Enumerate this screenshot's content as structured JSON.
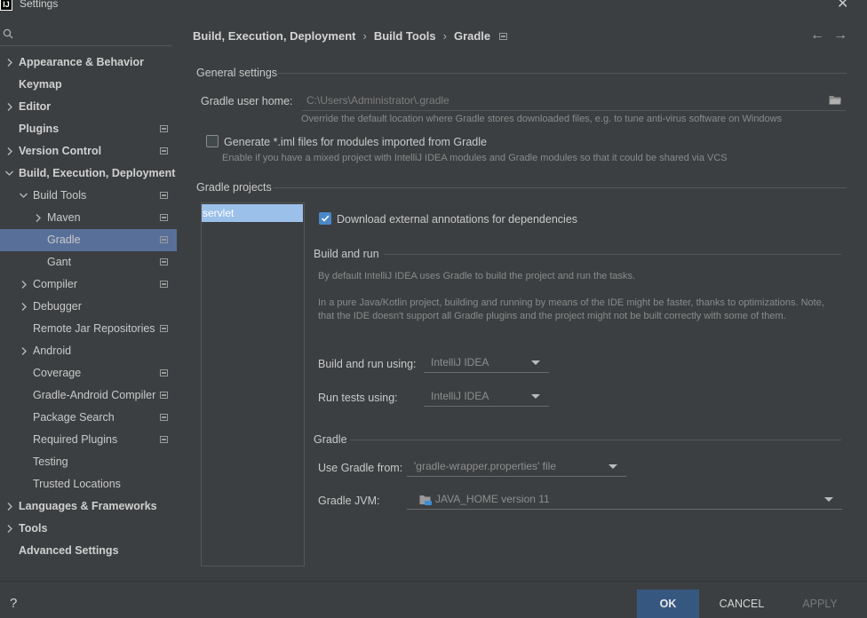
{
  "window": {
    "title": "Settings",
    "app_icon": "IJ"
  },
  "search": {
    "placeholder": ""
  },
  "sidebar": {
    "items": [
      {
        "label": "Appearance & Behavior"
      },
      {
        "label": "Keymap"
      },
      {
        "label": "Editor"
      },
      {
        "label": "Plugins"
      },
      {
        "label": "Version Control"
      },
      {
        "label": "Build, Execution, Deployment"
      },
      {
        "label": "Build Tools"
      },
      {
        "label": "Maven"
      },
      {
        "label": "Gradle"
      },
      {
        "label": "Gant"
      },
      {
        "label": "Compiler"
      },
      {
        "label": "Debugger"
      },
      {
        "label": "Remote Jar Repositories"
      },
      {
        "label": "Android"
      },
      {
        "label": "Coverage"
      },
      {
        "label": "Gradle-Android Compiler"
      },
      {
        "label": "Package Search"
      },
      {
        "label": "Required Plugins"
      },
      {
        "label": "Testing"
      },
      {
        "label": "Trusted Locations"
      },
      {
        "label": "Languages & Frameworks"
      },
      {
        "label": "Tools"
      },
      {
        "label": "Advanced Settings"
      }
    ]
  },
  "breadcrumb": {
    "items": [
      "Build, Execution, Deployment",
      "Build Tools",
      "Gradle"
    ],
    "separator": "›"
  },
  "nav": {
    "back": "←",
    "forward": "→"
  },
  "general": {
    "title": "General settings",
    "gradle_home_label": "Gradle user home:",
    "gradle_home_value": "C:\\Users\\Administrator\\.gradle",
    "gradle_home_hint": "Override the default location where Gradle stores downloaded files, e.g. to tune anti-virus software on Windows",
    "iml_label": "Generate *.iml files for modules imported from Gradle",
    "iml_hint": "Enable if you have a mixed project with IntelliJ IDEA modules and Gradle modules so that it could be shared via VCS"
  },
  "projects": {
    "title": "Gradle projects",
    "list": [
      "servlet"
    ],
    "download_annotations_label": "Download external annotations for dependencies"
  },
  "build_run": {
    "title": "Build and run",
    "desc1": "By default IntelliJ IDEA uses Gradle to build the project and run the tasks.",
    "desc2": "In a pure Java/Kotlin project, building and running by means of the IDE might be faster, thanks to optimizations. Note, that the IDE doesn't support all Gradle plugins and the project might not be built correctly with some of them.",
    "build_run_label": "Build and run using:",
    "build_run_value": "IntelliJ IDEA",
    "run_tests_label": "Run tests using:",
    "run_tests_value": "IntelliJ IDEA"
  },
  "gradle": {
    "title": "Gradle",
    "use_from_label": "Use Gradle from:",
    "use_from_value": "'gradle-wrapper.properties' file",
    "jvm_label": "Gradle JVM:",
    "jvm_value": "JAVA_HOME version 11"
  },
  "footer": {
    "help": "?",
    "ok": "OK",
    "cancel": "CANCEL",
    "apply": "APPLY"
  },
  "colors": {
    "accent": "#365880",
    "selection": "#587099",
    "background": "#3c3f41"
  }
}
